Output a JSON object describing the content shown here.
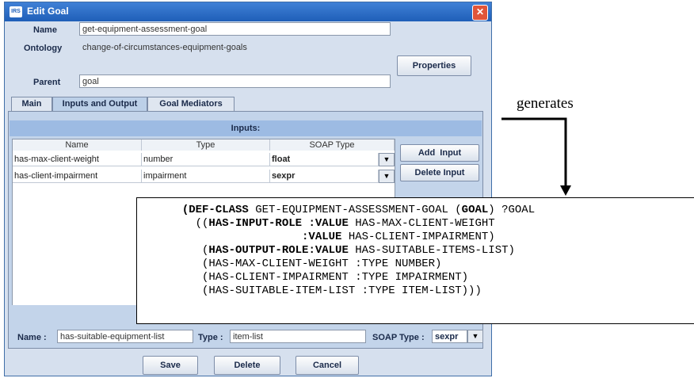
{
  "window": {
    "title": "Edit Goal",
    "app_icon_text": "IRS"
  },
  "form": {
    "name_label": "Name",
    "name_value": "get-equipment-assessment-goal",
    "ontology_label": "Ontology",
    "ontology_value": "change-of-circumstances-equipment-goals",
    "parent_label": "Parent",
    "parent_value": "goal",
    "properties_button": "Properties"
  },
  "tabs": [
    {
      "label": "Main"
    },
    {
      "label": "Inputs and Output",
      "active": true
    },
    {
      "label": "Goal Mediators"
    }
  ],
  "inputs": {
    "header": "Inputs:",
    "columns": [
      "Name",
      "Type",
      "SOAP Type"
    ],
    "rows": [
      {
        "name": "has-max-client-weight",
        "type": "number",
        "soap": "float"
      },
      {
        "name": "has-client-impairment",
        "type": "impairment",
        "soap": "sexpr"
      }
    ],
    "add_button": "Add  Input",
    "delete_button": "Delete Input"
  },
  "output": {
    "name_label": "Name :",
    "name_value": "has-suitable-equipment-list",
    "type_label": "Type :",
    "type_value": "item-list",
    "soap_label": "SOAP Type :",
    "soap_value": "sexpr"
  },
  "footer": {
    "save": "Save",
    "delete": "Delete",
    "cancel": "Cancel"
  },
  "annotation": {
    "generates": "generates",
    "code_lines": [
      [
        {
          "t": "  ",
          "b": false
        },
        {
          "t": "(DEF-CLASS",
          "b": true
        },
        {
          "t": " GET-EQUIPMENT-ASSESSMENT-GOAL (",
          "b": false
        },
        {
          "t": "GOAL",
          "b": true
        },
        {
          "t": ") ?GOAL",
          "b": false
        }
      ],
      [
        {
          "t": "    ((",
          "b": false
        },
        {
          "t": "HAS-INPUT-ROLE :VALUE",
          "b": true
        },
        {
          "t": " HAS-MAX-CLIENT-WEIGHT",
          "b": false
        }
      ],
      [
        {
          "t": "                    ",
          "b": false
        },
        {
          "t": ":VALUE",
          "b": true
        },
        {
          "t": " HAS-CLIENT-IMPAIRMENT)",
          "b": false
        }
      ],
      [
        {
          "t": "     (",
          "b": false
        },
        {
          "t": "HAS-OUTPUT-ROLE:VALUE",
          "b": true
        },
        {
          "t": " HAS-SUITABLE-ITEMS-LIST)",
          "b": false
        }
      ],
      [
        {
          "t": "     (HAS-MAX-CLIENT-WEIGHT :TYPE NUMBER)",
          "b": false
        }
      ],
      [
        {
          "t": "     (HAS-CLIENT-IMPAIRMENT :TYPE IMPAIRMENT)",
          "b": false
        }
      ],
      [
        {
          "t": "     (HAS-SUITABLE-ITEM-LIST :TYPE ITEM-LIST)))",
          "b": false
        }
      ]
    ]
  }
}
